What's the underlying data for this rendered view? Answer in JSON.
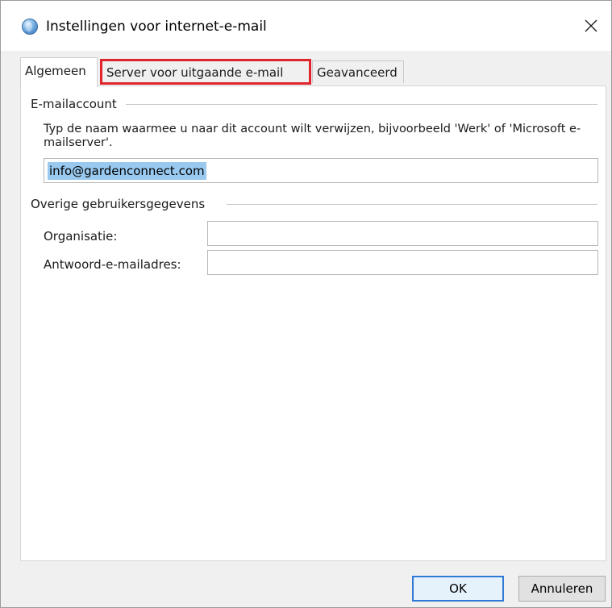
{
  "window": {
    "title": "Instellingen voor internet-e-mail"
  },
  "icons": {
    "app": "globe-mail-icon",
    "close": "close-icon"
  },
  "colors": {
    "highlight": "#e0242b",
    "selection": "#99c9ef",
    "default_button_border": "#2f7ad6"
  },
  "tabs": [
    {
      "label": "Algemeen",
      "active": true
    },
    {
      "label": "Server voor uitgaande e-mail",
      "active": false,
      "highlighted": true
    },
    {
      "label": "Geavanceerd",
      "active": false
    }
  ],
  "email_account": {
    "group_label": "E-mailaccount",
    "description": "Typ de naam waarmee u naar dit account wilt verwijzen, bijvoorbeeld 'Werk' of 'Microsoft e-mailserver'.",
    "value": "info@gardenconnect.com"
  },
  "other_info": {
    "group_label": "Overige gebruikersgegevens",
    "organization_label": "Organisatie:",
    "organization_value": "",
    "reply_email_label": "Antwoord-e-mailadres:",
    "reply_email_value": ""
  },
  "buttons": {
    "ok": "OK",
    "cancel": "Annuleren"
  }
}
